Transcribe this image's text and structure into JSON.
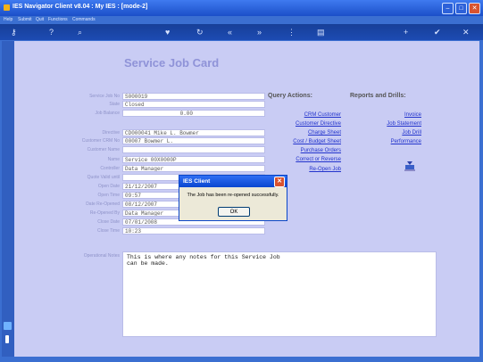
{
  "window": {
    "title": "IES Navigator Client v8.04 : My IES :       [mode-2]"
  },
  "menu": [
    "Help",
    "Submit",
    "Quit",
    "Functions",
    "Commands"
  ],
  "toolbar": [
    {
      "icon": "key-icon",
      "glyph": "⚷"
    },
    {
      "icon": "help-icon",
      "glyph": "?"
    },
    {
      "icon": "search-icon",
      "glyph": "⌕"
    },
    {
      "icon": "heart-icon",
      "glyph": "♥"
    },
    {
      "icon": "refresh-icon",
      "glyph": "↻"
    },
    {
      "icon": "back-icon",
      "glyph": "«"
    },
    {
      "icon": "forward-icon",
      "glyph": "»"
    },
    {
      "icon": "grid-icon",
      "glyph": "⋮"
    },
    {
      "icon": "doc-icon",
      "glyph": "▤"
    },
    {
      "icon": "add-icon",
      "glyph": "+"
    },
    {
      "icon": "ok-icon",
      "glyph": "✔"
    },
    {
      "icon": "close-icon",
      "glyph": "✕"
    }
  ],
  "page": {
    "title": "Service Job Card"
  },
  "form": [
    {
      "label": "Service Job No",
      "value": "S000019"
    },
    {
      "label": "State",
      "value": "Closed"
    },
    {
      "label": "Job Balance",
      "value": "0.00"
    },
    {
      "label": "Directive",
      "value": "CD000041 Mike L. Bowmer"
    },
    {
      "label": "Customer CRM No",
      "value": "00007 Bowmer L."
    },
    {
      "label": "Customer Name",
      "value": ""
    },
    {
      "label": "Name",
      "value": "Service 00X0000P"
    },
    {
      "label": "Controller",
      "value": "Data Manager"
    },
    {
      "label": "Quote Valid until",
      "value": ""
    },
    {
      "label": "Open Date",
      "value": "21/12/2007"
    },
    {
      "label": "Open Time",
      "value": "09:57"
    },
    {
      "label": "Date Re-Opened",
      "value": "08/12/2007"
    },
    {
      "label": "Re-Opened By",
      "value": "Data Manager"
    },
    {
      "label": "Close Date",
      "value": "07/01/2008"
    },
    {
      "label": "Close Time",
      "value": "10:23"
    }
  ],
  "notes": {
    "label": "Operational Notes",
    "text": "This is where any notes for this Service Job\ncan be made."
  },
  "query": {
    "heading": "Query Actions:",
    "links": [
      "CRM Customer",
      "Customer Directive",
      "Charge Sheet",
      "Cost / Budget Sheet",
      "Purchase Orders",
      "Correct or Reverse",
      "Re-Open Job"
    ]
  },
  "reports": {
    "heading": "Reports and Drills:",
    "links": [
      "Invoice",
      "Job Statement",
      "Job Drill",
      "Performance"
    ]
  },
  "dialog": {
    "title": "IES Client",
    "message": "The Job has been re-opened successfully.",
    "ok": "OK"
  }
}
